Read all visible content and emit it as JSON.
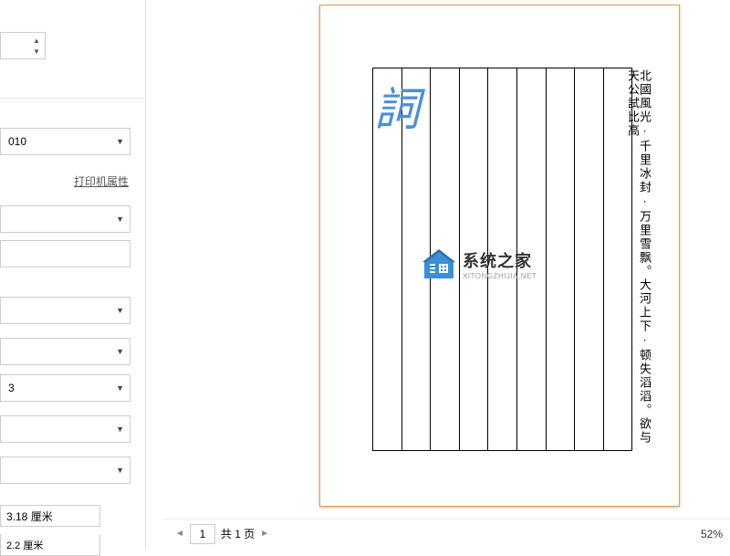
{
  "sidebar": {
    "printer_option": "010",
    "printer_props_link": "打印机属性",
    "option_3": "3",
    "margin_value": "3.18 厘米",
    "margin_value2": "2.2 厘米"
  },
  "preview": {
    "document_text": "北國風光·千里冰封·万里雪飘。大河上下·顿失滔滔。欲与天公試比高",
    "ci_label": "詞"
  },
  "watermark": {
    "cn": "系统之家",
    "en": "XITONGZHIJIA.NET"
  },
  "footer": {
    "page_current": "1",
    "page_total_label": "共 1 页",
    "zoom": "52%"
  }
}
